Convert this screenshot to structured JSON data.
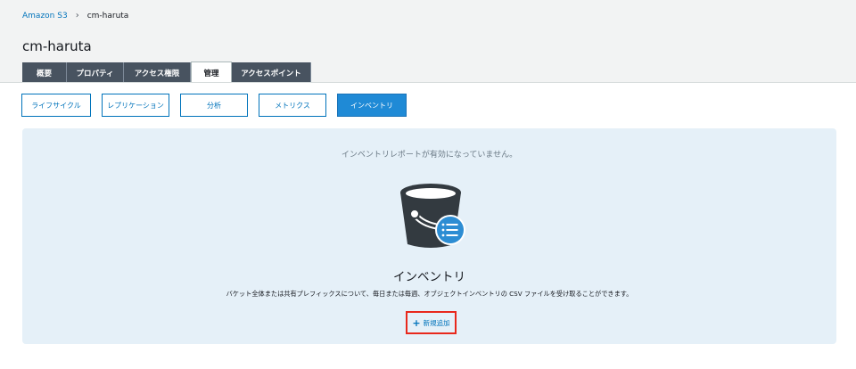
{
  "breadcrumb": {
    "root": "Amazon S3",
    "separator": "›",
    "current": "cm-haruta"
  },
  "bucket": {
    "name": "cm-haruta"
  },
  "tabs": [
    {
      "label": "概要"
    },
    {
      "label": "プロパティ"
    },
    {
      "label": "アクセス権限"
    },
    {
      "label": "管理"
    },
    {
      "label": "アクセスポイント"
    }
  ],
  "subtabs": [
    {
      "label": "ライフサイクル"
    },
    {
      "label": "レプリケーション"
    },
    {
      "label": "分析"
    },
    {
      "label": "メトリクス"
    },
    {
      "label": "インベントリ"
    }
  ],
  "panel": {
    "empty_message": "インベントリレポートが有効になっていません。",
    "title": "インベントリ",
    "description": "バケット全体または共有プレフィックスについて、毎日または毎週、オブジェクトインベントリの CSV ファイルを受け取ることができます。",
    "add_plus": "+",
    "add_label": "新規追加"
  },
  "colors": {
    "accent": "#0073bb",
    "active_subtab": "#1f8ad6",
    "tab_bg": "#485360",
    "highlight": "#e8281c"
  }
}
